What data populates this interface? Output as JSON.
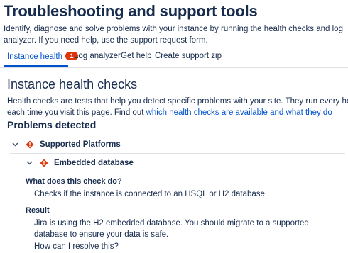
{
  "header": {
    "title": "Troubleshooting and support tools",
    "description": "Identify, diagnose and solve problems with your instance by running the health checks and log analyzer. If you need help, use the support request form."
  },
  "tabs": [
    {
      "label": "Instance health",
      "badge": "1",
      "active": true
    },
    {
      "label": "Log analyzer"
    },
    {
      "label": "Get help"
    },
    {
      "label": "Create support zip"
    }
  ],
  "health": {
    "title": "Instance health checks",
    "description_prefix": "Health checks are tests that help you detect specific problems with your site. They run every hour and each time you visit this page. Find out ",
    "description_link": "which health checks are available and what they do"
  },
  "problems": {
    "title": "Problems detected",
    "groups": [
      {
        "label": "Supported Platforms",
        "checks": [
          {
            "label": "Embedded database",
            "what_label": "What does this check do?",
            "what_text": "Checks if the instance is connected to an HSQL or H2 database",
            "result_label": "Result",
            "result_text": "Jira is using the H2 embedded database. You should migrate to a supported database to ensure your data is safe.",
            "resolve_link": "How can I resolve this?"
          }
        ]
      }
    ]
  },
  "colors": {
    "text": "#172b4d",
    "link": "#0052cc",
    "error": "#de350b",
    "divider": "#dfe1e6"
  },
  "icons": {
    "expanded": "chevron-down-icon",
    "error": "error-icon"
  }
}
